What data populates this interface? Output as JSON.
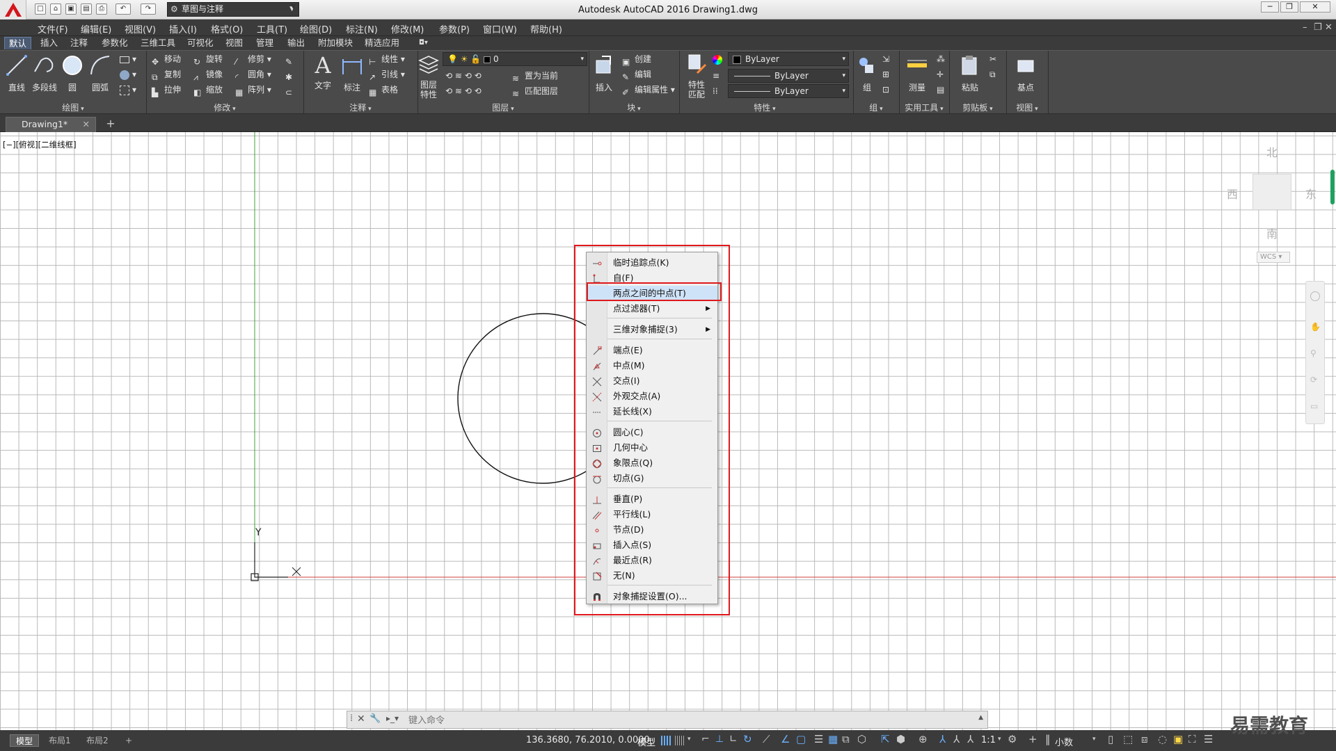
{
  "titlebar": {
    "workspace": "草图与注释",
    "title": "Autodesk AutoCAD 2016    Drawing1.dwg",
    "min": "─",
    "restore": "❐",
    "close": "✕"
  },
  "menubar": [
    "文件(F)",
    "编辑(E)",
    "视图(V)",
    "插入(I)",
    "格式(O)",
    "工具(T)",
    "绘图(D)",
    "标注(N)",
    "修改(M)",
    "参数(P)",
    "窗口(W)",
    "帮助(H)"
  ],
  "ribbon_tabs": [
    "默认",
    "插入",
    "注释",
    "参数化",
    "三维工具",
    "可视化",
    "视图",
    "管理",
    "输出",
    "附加模块",
    "精选应用"
  ],
  "ribbon": {
    "draw": {
      "title": "绘图",
      "line": "直线",
      "polyline": "多段线",
      "circle": "圆",
      "arc": "圆弧"
    },
    "modify": {
      "title": "修改",
      "move": "移动",
      "rotate": "旋转",
      "trim": "修剪",
      "copy": "复制",
      "mirror": "镜像",
      "fillet": "圆角",
      "stretch": "拉伸",
      "scale": "缩放",
      "array": "阵列"
    },
    "annotation": {
      "title": "注释",
      "text": "文字",
      "dimension": "标注",
      "linear": "线性",
      "leader": "引线",
      "table": "表格"
    },
    "layers": {
      "title": "图层",
      "props": "图层\n特性",
      "current_layer": "0",
      "set_current": "置为当前",
      "match_layer": "匹配图层"
    },
    "block": {
      "title": "块",
      "insert": "插入",
      "create": "创建",
      "edit": "编辑",
      "edit_attr": "编辑属性"
    },
    "properties": {
      "title": "特性",
      "match": "特性\n匹配",
      "color": "ByLayer",
      "linetype": "ByLayer",
      "lineweight": "ByLayer"
    },
    "groups": {
      "title": "组",
      "group": "组"
    },
    "utilities": {
      "title": "实用工具",
      "measure": "测量"
    },
    "clipboard": {
      "title": "剪贴板",
      "paste": "粘贴"
    },
    "view": {
      "title": "视图",
      "base": "基点"
    }
  },
  "doc_tab": {
    "name": "Drawing1*",
    "close": "✕",
    "new": "+"
  },
  "viewport_label": "[−][俯视][二维线框]",
  "viewcube": {
    "north": "北",
    "south": "南",
    "east": "东",
    "west": "西",
    "wcs": "WCS"
  },
  "ucs": {
    "x": "X",
    "y": "Y"
  },
  "context_menu": [
    {
      "label": "临时追踪点(K)",
      "icon": "temp-track-icon"
    },
    {
      "label": "自(F)",
      "icon": "from-icon"
    },
    {
      "label": "两点之间的中点(T)",
      "icon": "",
      "highlight": true
    },
    {
      "label": "点过滤器(T)",
      "icon": "",
      "submenu": true
    },
    {
      "label": "三维对象捕捉(3)",
      "icon": "",
      "submenu": true
    },
    {
      "label": "端点(E)",
      "icon": "endpoint-icon"
    },
    {
      "label": "中点(M)",
      "icon": "midpoint-icon"
    },
    {
      "label": "交点(I)",
      "icon": "intersection-icon"
    },
    {
      "label": "外观交点(A)",
      "icon": "apparent-intersection-icon"
    },
    {
      "label": "延长线(X)",
      "icon": "extension-icon"
    },
    {
      "label": "圆心(C)",
      "icon": "center-icon"
    },
    {
      "label": "几何中心",
      "icon": "geometric-center-icon"
    },
    {
      "label": "象限点(Q)",
      "icon": "quadrant-icon"
    },
    {
      "label": "切点(G)",
      "icon": "tangent-icon"
    },
    {
      "label": "垂直(P)",
      "icon": "perpendicular-icon"
    },
    {
      "label": "平行线(L)",
      "icon": "parallel-icon"
    },
    {
      "label": "节点(D)",
      "icon": "node-icon"
    },
    {
      "label": "插入点(S)",
      "icon": "insertion-icon"
    },
    {
      "label": "最近点(R)",
      "icon": "nearest-icon"
    },
    {
      "label": "无(N)",
      "icon": "none-icon"
    },
    {
      "label": "对象捕捉设置(O)...",
      "icon": "osnap-settings-icon"
    }
  ],
  "command_line": {
    "placeholder": "键入命令"
  },
  "layout_tabs": [
    "模型",
    "布局1",
    "布局2",
    "+"
  ],
  "status": {
    "coords": "136.3680, 76.2010, 0.0000",
    "model": "模型",
    "scale": "1:1",
    "units": "小数"
  },
  "watermark": "易需教育",
  "colors": {
    "highlight_box": "#e0181c",
    "x_axis": "#d04040",
    "y_axis": "#40a040"
  }
}
